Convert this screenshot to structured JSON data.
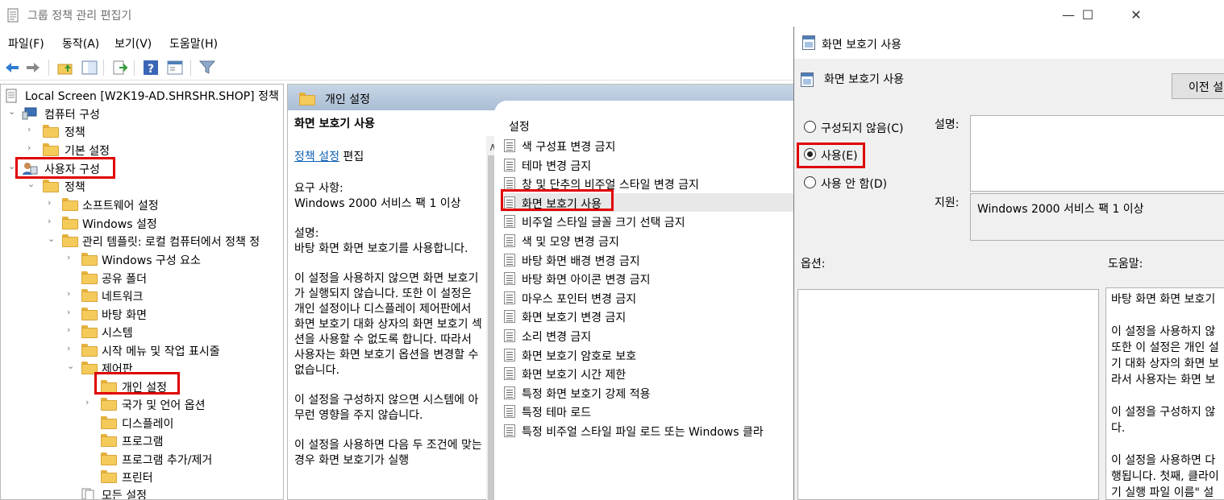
{
  "window": {
    "title": "그룹 정책 관리 편집기",
    "minimize": "—",
    "maximize": "☐",
    "close": "✕"
  },
  "menu": [
    "파일(F)",
    "동작(A)",
    "보기(V)",
    "도움말(H)"
  ],
  "tree": {
    "root": "Local Screen [W2K19-AD.SHRSHR.SHOP] 정책",
    "computer": "컴퓨터 구성",
    "policies": "정책",
    "prefs": "기본 설정",
    "user": "사용자 구성",
    "user_policies": "정책",
    "software": "소프트웨어 설정",
    "windows": "Windows 설정",
    "admin": "관리 템플릿: 로컬 컴퓨터에서 정책 정",
    "win_components": "Windows 구성 요소",
    "shared": "공유 폴더",
    "network": "네트워크",
    "desktop": "바탕 화면",
    "system": "시스템",
    "startmenu": "시작 메뉴 및 작업 표시줄",
    "control": "제어판",
    "personal": "개인 설정",
    "region": "국가 및 언어 옵션",
    "display": "디스플레이",
    "programs": "프로그램",
    "addremove": "프로그램 추가/제거",
    "printers": "프린터",
    "all": "모든 설정"
  },
  "middle": {
    "header": "개인 설정",
    "desc_title": "화면 보호기 사용",
    "edit_link": "정책 설정",
    "edit_text": " 편집",
    "req_label": "요구 사항:",
    "req_value": "Windows 2000 서비스 팩 1 이상",
    "desc_label": "설명:",
    "desc_1": "바탕 화면 화면 보호기를 사용합니다.",
    "desc_2": "이 설정을 사용하지 않으면 화면 보호기가 실행되지 않습니다. 또한 이 설정은 개인 설정이나 디스플레이 제어판에서 화면 보호기 대화 상자의 화면 보호기 섹션을 사용할 수 없도록 합니다. 따라서 사용자는 화면 보호기 옵션을 변경할 수 없습니다.",
    "desc_3": "이 설정을 구성하지 않으면 시스템에 아무런 영향을 주지 않습니다.",
    "desc_4": "이 설정을 사용하면 다음 두 조건에 맞는 경우 화면 보호기가 실행",
    "settings_header": "설정",
    "settings": [
      "색 구성표 변경 금지",
      "테마 변경 금지",
      "창 및 단추의 비주얼 스타일 변경 금지",
      "화면 보호기 사용",
      "비주얼 스타일 글꼴 크기 선택 금지",
      "색 및 모양 변경 금지",
      "바탕 화면 배경 변경 금지",
      "바탕 화면 아이콘 변경 금지",
      "마우스 포인터 변경 금지",
      "화면 보호기 변경 금지",
      "소리 변경 금지",
      "화면 보호기 암호로 보호",
      "화면 보호기 시간 제한",
      "특정 화면 보호기 강제 적용",
      "특정 테마 로드",
      "특정 비주얼 스타일 파일 로드 또는 Windows 클라"
    ]
  },
  "dialog": {
    "title": "화면 보호기 사용",
    "subtitle": "화면 보호기 사용",
    "prev_button": "이전 설",
    "radio_not_configured": "구성되지 않음(C)",
    "radio_enabled": "사용(E)",
    "radio_disabled": "사용 안 함(D)",
    "comment_label": "설명:",
    "support_label": "지원:",
    "support_value": "Windows 2000 서비스 팩 1 이상",
    "options_label": "옵션:",
    "help_label": "도움말:",
    "help_lines": [
      "바탕 화면 화면 보호기",
      "",
      "이 설정을 사용하지 않",
      "또한 이 설정은 개인 설",
      "기 대화 상자의 화면 보",
      "라서 사용자는 화면 보",
      "",
      "이 설정을 구성하지 않",
      "다.",
      "",
      "이 설정을 사용하면 다",
      "행됩니다. 첫째, 클라이",
      "기 실행 파일 이름\" 설"
    ]
  }
}
